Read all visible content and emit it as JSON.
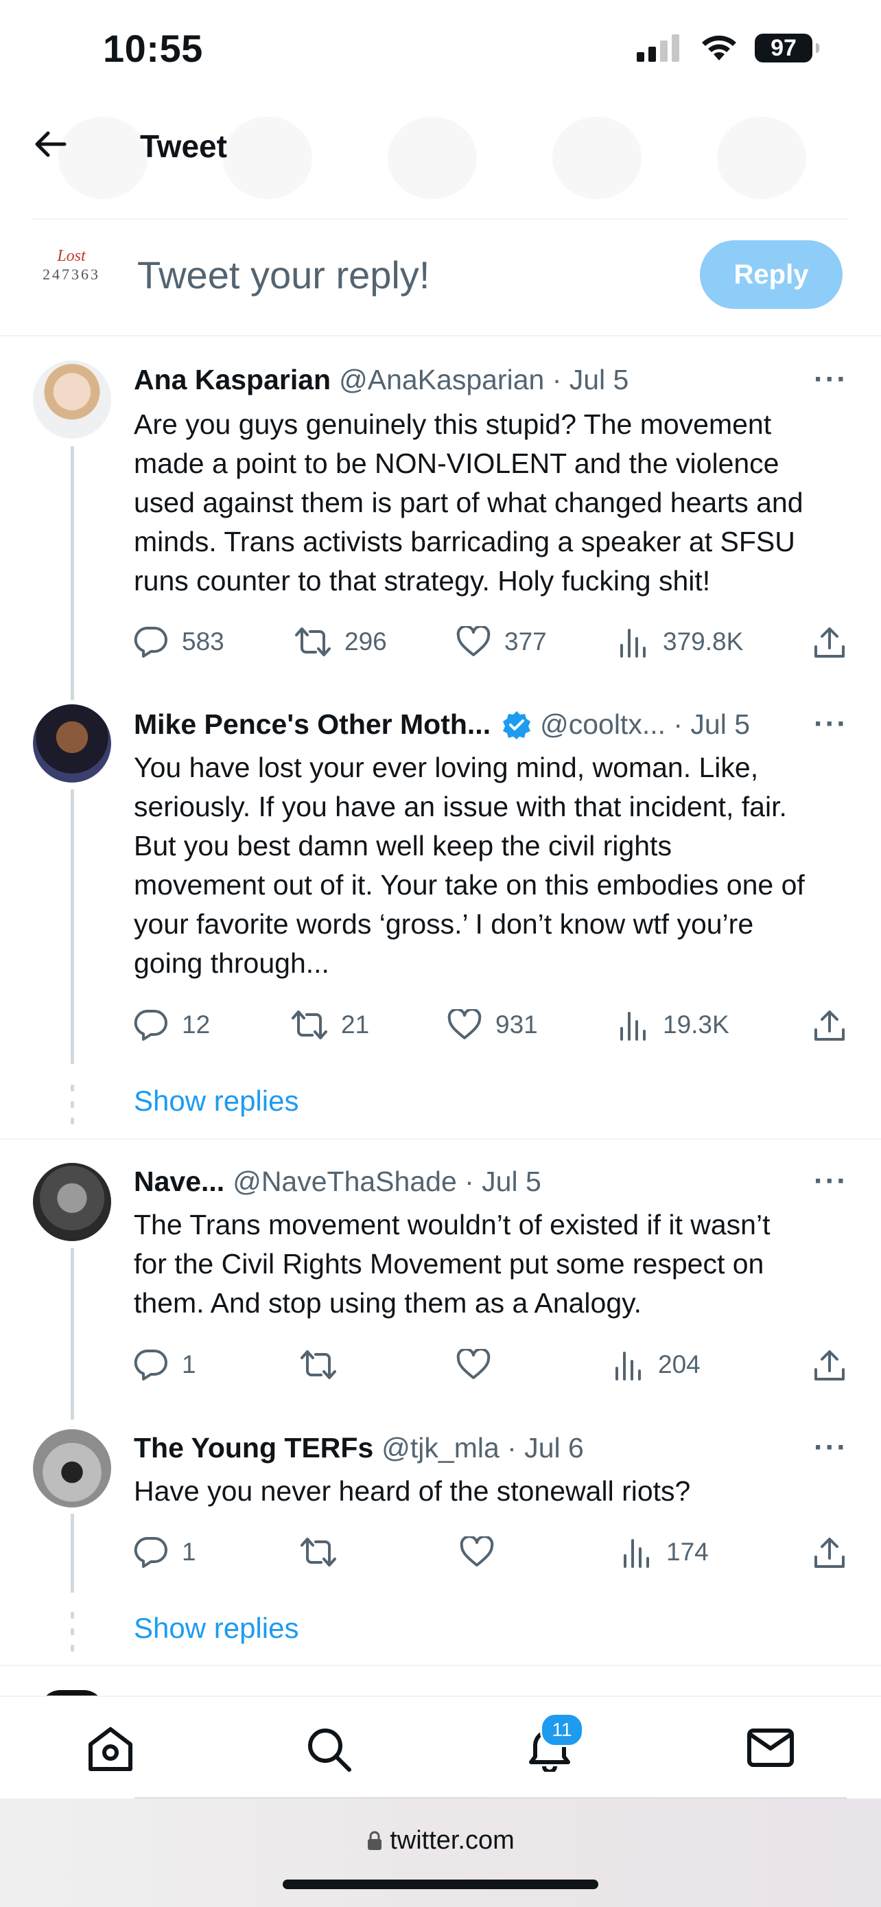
{
  "status": {
    "time": "10:55",
    "battery": "97"
  },
  "header": {
    "title": "Tweet"
  },
  "composer": {
    "placeholder": "Tweet your reply!",
    "reply_label": "Reply",
    "avatar_text_top": "Lost",
    "avatar_text_bottom": "247363"
  },
  "tweets": [
    {
      "name": "Ana Kasparian",
      "handle": "@AnaKasparian · Jul 5",
      "lines": [
        "Are you guys genuinely this stupid? The movement",
        "made a point to be NON-VIOLENT and the violence",
        "used against them is part of what changed hearts and",
        "minds. Trans activists barricading a speaker at SFSU",
        "runs counter to that strategy. Holy fucking shit!"
      ],
      "replies": "583",
      "retweets": "296",
      "likes": "377",
      "views": "379.8K"
    },
    {
      "name": "Mike Pence's Other Moth...",
      "handle": "@cooltx... · Jul 5",
      "verified": true,
      "lines": [
        "You have lost your ever loving mind, woman. Like,",
        "seriously. If you have an issue with that incident, fair.",
        "But you best damn well keep the civil rights",
        "movement out of it. Your take on this embodies one of",
        "your favorite words ‘gross.’ I don’t know wtf you’re",
        "going through..."
      ],
      "replies": "12",
      "retweets": "21",
      "likes": "931",
      "views": "19.3K"
    },
    {
      "name": "Nave...",
      "handle": "@NaveThaShade · Jul 5",
      "lines": [
        "The Trans movement wouldn’t of existed if it wasn’t",
        "for the Civil Rights Movement put some respect on",
        "them. And stop using them as a Analogy."
      ],
      "replies": "1",
      "retweets": "",
      "likes": "",
      "views": "204"
    },
    {
      "name": "The Young TERFs",
      "handle": "@tjk_mla · Jul 6",
      "lines": [
        "Have you never heard of the stonewall riots?"
      ],
      "replies": "1",
      "retweets": "",
      "likes": "",
      "views": "174"
    }
  ],
  "show_replies": "Show replies",
  "more_label": "···",
  "tabbar": {
    "notifications_badge": "11"
  },
  "browser": {
    "url": "twitter.com"
  },
  "colors": {
    "accent": "#1d9bf0",
    "reply_button": "#8ecdf8",
    "secondary_text": "#536471"
  }
}
